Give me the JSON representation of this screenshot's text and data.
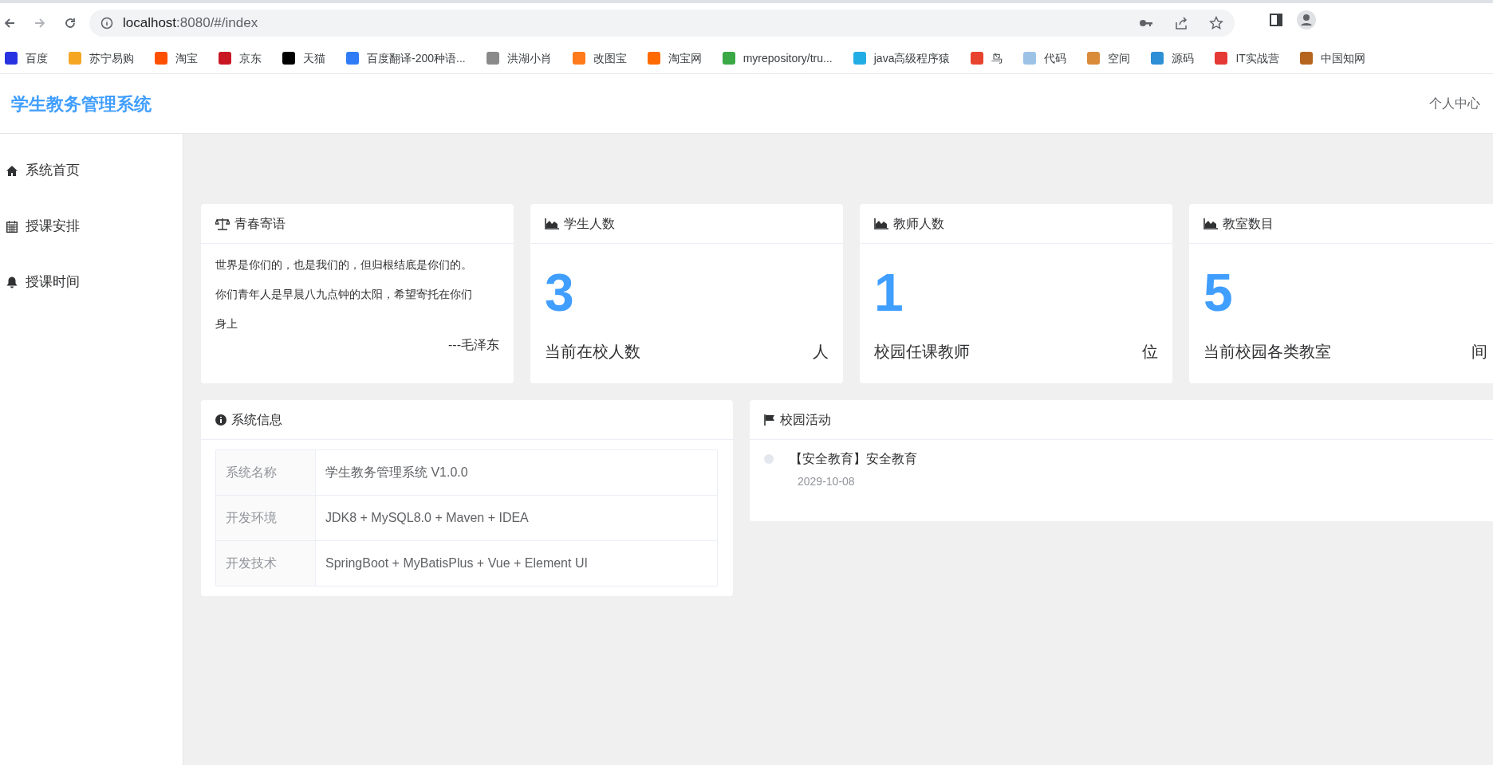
{
  "browser": {
    "url_host": "localhost",
    "url_rest": ":8080/#/index"
  },
  "bookmarks": [
    {
      "label": "百度",
      "color": "#2932e1"
    },
    {
      "label": "苏宁易购",
      "color": "#f5a623"
    },
    {
      "label": "淘宝",
      "color": "#ff5000"
    },
    {
      "label": "京东",
      "color": "#c91623"
    },
    {
      "label": "天猫",
      "color": "#000000"
    },
    {
      "label": "百度翻译-200种语...",
      "color": "#2f7cf6"
    },
    {
      "label": "洪湖小肖",
      "color": "#8a8a8a"
    },
    {
      "label": "改图宝",
      "color": "#ff7a1a"
    },
    {
      "label": "淘宝网",
      "color": "#ff6a00"
    },
    {
      "label": "myrepository/tru...",
      "color": "#3aa845"
    },
    {
      "label": "java高级程序猿",
      "color": "#23ade5"
    },
    {
      "label": "鸟",
      "color": "#e8432e"
    },
    {
      "label": "代码",
      "color": "#9cc3e6"
    },
    {
      "label": "空间",
      "color": "#d98b3a"
    },
    {
      "label": "源码",
      "color": "#2d8fd5"
    },
    {
      "label": "IT实战营",
      "color": "#e53935"
    },
    {
      "label": "中国知网",
      "color": "#b5651d"
    }
  ],
  "header": {
    "title": "学生教务管理系统",
    "user_menu": "个人中心"
  },
  "sidebar": {
    "items": [
      {
        "label": "系统首页",
        "kind": "home",
        "selected": false
      },
      {
        "label": "授课安排",
        "kind": "calendar",
        "selected": false
      },
      {
        "label": "授课时间",
        "kind": "bell",
        "selected": false
      }
    ]
  },
  "quote_card": {
    "title": "青春寄语",
    "text": "世界是你们的，也是我们的，但归根结底是你们的。你们青年人是早晨八九点钟的太阳，希望寄托在你们身上",
    "author": "---毛泽东"
  },
  "stat_cards": [
    {
      "title": "学生人数",
      "value": "3",
      "caption": "当前在校人数",
      "unit": "人"
    },
    {
      "title": "教师人数",
      "value": "1",
      "caption": "校园任课教师",
      "unit": "位"
    },
    {
      "title": "教室数目",
      "value": "5",
      "caption": "当前校园各类教室",
      "unit": "间"
    }
  ],
  "system_info": {
    "title": "系统信息",
    "rows": [
      {
        "label": "系统名称",
        "value": "学生教务管理系统 V1.0.0"
      },
      {
        "label": "开发环境",
        "value": "JDK8 + MySQL8.0 + Maven + IDEA"
      },
      {
        "label": "开发技术",
        "value": "SpringBoot + MyBatisPlus + Vue + Element UI"
      }
    ]
  },
  "activities": {
    "title": "校园活动",
    "items": [
      {
        "title": "【安全教育】安全教育",
        "date": "2029-10-08"
      }
    ]
  }
}
